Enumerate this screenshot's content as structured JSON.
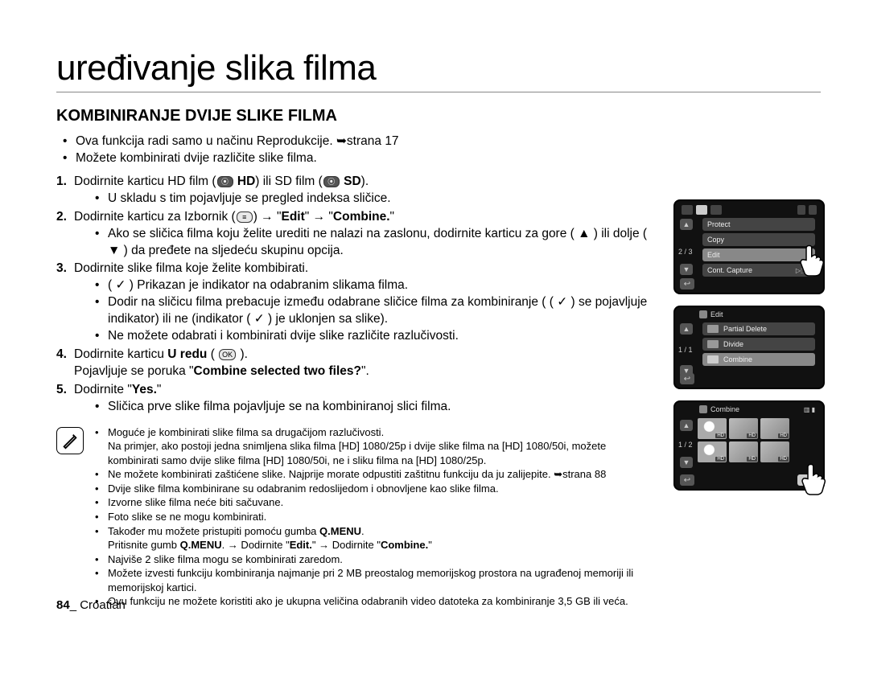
{
  "title": "uređivanje slika filma",
  "subtitle": "KOMBINIRANJE DVIJE SLIKE FILMA",
  "intro_bullets": [
    "Ova funkcija radi samo u načinu Reprodukcije. ➥strana 17",
    "Možete kombinirati dvije različite slike filma."
  ],
  "steps": {
    "s1": {
      "num": "1.",
      "text_a": "Dodirnite karticu HD film (",
      "bold_a": "HD",
      "text_b": ") ili SD film (",
      "bold_b": "SD",
      "text_c": ")."
    },
    "s1_sub1": "U skladu s tim pojavljuje se pregled indeksa sličice.",
    "s2": {
      "num": "2.",
      "text_a": "Dodirnite karticu za Izbornik (",
      "text_b": ") → \"",
      "bold_a": "Edit",
      "text_c": "\" → \"",
      "bold_b": "Combine.",
      "text_d": "\""
    },
    "s2_sub1": "Ako se sličica filma koju želite urediti ne nalazi na zaslonu, dodirnite karticu za gore ( ▲ ) ili dolje ( ▼ ) da pređete na sljedeću skupinu opcija.",
    "s3": {
      "num": "3.",
      "text": "Dodirnite slike filma koje želite kombibirati."
    },
    "s3_sub1": "( ✓ ) Prikazan je indikator na odabranim slikama filma.",
    "s3_sub2": "Dodir na sličicu filma prebacuje između odabrane sličice filma za kombiniranje ( ( ✓ ) se pojavljuje indikator) ili ne (indikator ( ✓ ) je uklonjen sa slike).",
    "s3_sub3": "Ne možete odabrati i kombinirati dvije slike različite razlučivosti.",
    "s4": {
      "num": "4.",
      "text_a": "Dodirnite karticu ",
      "bold_a": "U redu",
      "text_b": " ( ",
      "text_c": " )."
    },
    "s4_line": "Pojavljuje se poruka \"",
    "s4_bold": "Combine selected two files?",
    "s4_end": "\".",
    "s5": {
      "num": "5.",
      "text_a": "Dodirnite \"",
      "bold_a": "Yes.",
      "text_b": "\""
    },
    "s5_sub1": "Sličica prve slike filma pojavljuje se na kombiniranoj slici filma."
  },
  "notes": [
    "Moguće je kombinirati slike filma sa drugačijom razlučivosti.\nNa primjer, ako postoji jedna snimljena slika filma [HD] 1080/25p i dvije slike filma na [HD] 1080/50i, možete kombinirati samo dvije slike filma [HD] 1080/50i, ne i sliku filma na [HD] 1080/25p.",
    "Ne možete kombinirati zaštićene slike. Najprije morate odpustiti zaštitnu funkciju da ju zalijepite. ➥strana 88",
    "Dvije slike filma kombinirane su odabranim redoslijedom i obnovljene kao slike filma.",
    "Izvorne slike filma neće biti sačuvane.",
    "Foto slike se ne mogu kombinirati.",
    "Također mu možete pristupiti pomoću gumba Q.MENU.\nPritisnite gumb Q.MENU. → Dodirnite \"Edit.\" → Dodirnite \"Combine.\"",
    "Najviše 2 slike filma mogu se kombinirati zaredom.",
    "Možete izvesti funkciju kombiniranja najmanje pri 2 MB preostalog memorijskog prostora na ugrađenoj memoriji ili memorijskoj kartici.",
    "Ovu funkciju ne možete koristiti ako je ukupna veličina odabranih video datoteka za kombiniranje 3,5 GB ili veća."
  ],
  "note_special_index": 5,
  "note_bold_map": {
    "5": [
      "Q.MENU",
      "Q.MENU.",
      "Edit.",
      "Combine."
    ]
  },
  "footer": {
    "num": "84",
    "sep": "_ ",
    "lang": "Croatian"
  },
  "screens": {
    "s1": {
      "rows": [
        "Protect",
        "Copy",
        "Edit",
        "Cont. Capture"
      ],
      "counter": "2 / 3"
    },
    "s2": {
      "title": "Edit",
      "rows": [
        "Partial Delete",
        "Divide",
        "Combine"
      ],
      "counter": "1 / 1"
    },
    "s3": {
      "title": "Combine",
      "counter": "1 / 2",
      "ok": "OK",
      "hd": "HD"
    }
  }
}
